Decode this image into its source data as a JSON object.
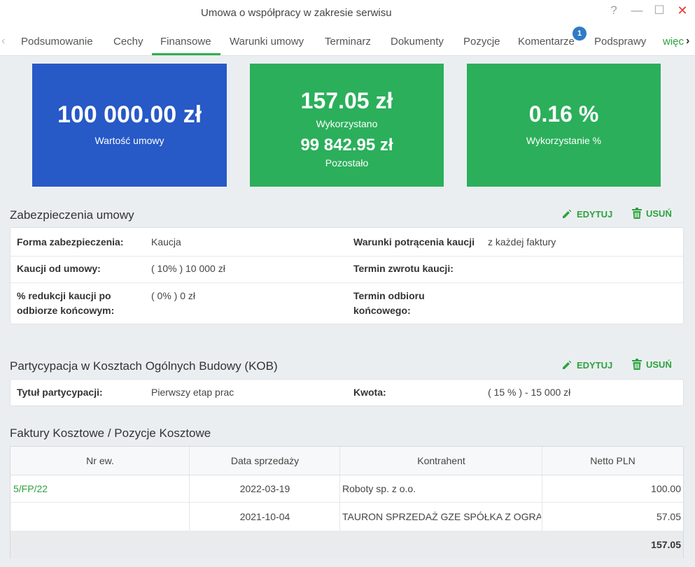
{
  "window": {
    "title": "Umowa o współpracy w zakresie serwisu",
    "help_glyph": "?",
    "minimize_glyph": "—",
    "maximize_glyph": "☐",
    "close_glyph": "✕"
  },
  "tabs": {
    "prev_glyph": "‹",
    "next_glyph": "›",
    "items": [
      {
        "label": "Podsumowanie"
      },
      {
        "label": "Cechy"
      },
      {
        "label": "Finansowe"
      },
      {
        "label": "Warunki umowy"
      },
      {
        "label": "Terminarz"
      },
      {
        "label": "Dokumenty"
      },
      {
        "label": "Pozycje"
      },
      {
        "label": "Komentarze"
      },
      {
        "label": "Podsprawy"
      },
      {
        "label": "więc"
      }
    ],
    "active_index": 2,
    "comments_badge": "1"
  },
  "tiles": {
    "contract_value": {
      "value": "100 000.00 zł",
      "label": "Wartość umowy",
      "color": "#2759c7"
    },
    "usage": {
      "used_value": "157.05 zł",
      "used_label": "Wykorzystano",
      "remaining_value": "99 842.95 zł",
      "remaining_label": "Pozostało",
      "color": "#2baf5b"
    },
    "usage_percent": {
      "value": "0.16 %",
      "label": "Wykorzystanie %",
      "color": "#2baf5b"
    }
  },
  "actions": {
    "edit_label": "EDYTUJ",
    "delete_label": "USUŃ",
    "accent_color": "#2ba23e"
  },
  "security": {
    "title": "Zabezpieczenia umowy",
    "rows": [
      {
        "label1": "Forma zabezpieczenia:",
        "value1": "Kaucja",
        "label2": "Warunki potrącenia kaucji",
        "value2": "z każdej faktury"
      },
      {
        "label1": "Kaucji od umowy:",
        "value1": "( 10% ) 10 000 zł",
        "label2": "Termin zwrotu kaucji:",
        "value2": ""
      },
      {
        "label1": "% redukcji kaucji po odbiorze końcowym:",
        "value1": "( 0% ) 0 zł",
        "label2": "Termin odbioru końcowego:",
        "value2": ""
      }
    ]
  },
  "kob": {
    "title": "Partycypacja w Kosztach Ogólnych Budowy (KOB)",
    "label1": "Tytuł partycypacji:",
    "value1": "Pierwszy etap prac",
    "label2": "Kwota:",
    "value2": "( 15 % ) - 15 000 zł"
  },
  "invoices": {
    "title": "Faktury Kosztowe / Pozycje Kosztowe",
    "columns": [
      "Nr ew.",
      "Data sprzedaży",
      "Kontrahent",
      "Netto PLN"
    ],
    "rows": [
      {
        "nr": "5/FP/22",
        "date": "2022-03-19",
        "contractor": "Roboty sp. z o.o.",
        "net": "100.00"
      },
      {
        "nr": "",
        "date": "2021-10-04",
        "contractor": "TAURON SPRZEDAŻ GZE SPÓŁKA Z OGRANICZONĄ",
        "net": "57.05"
      }
    ],
    "total": "157.05"
  }
}
